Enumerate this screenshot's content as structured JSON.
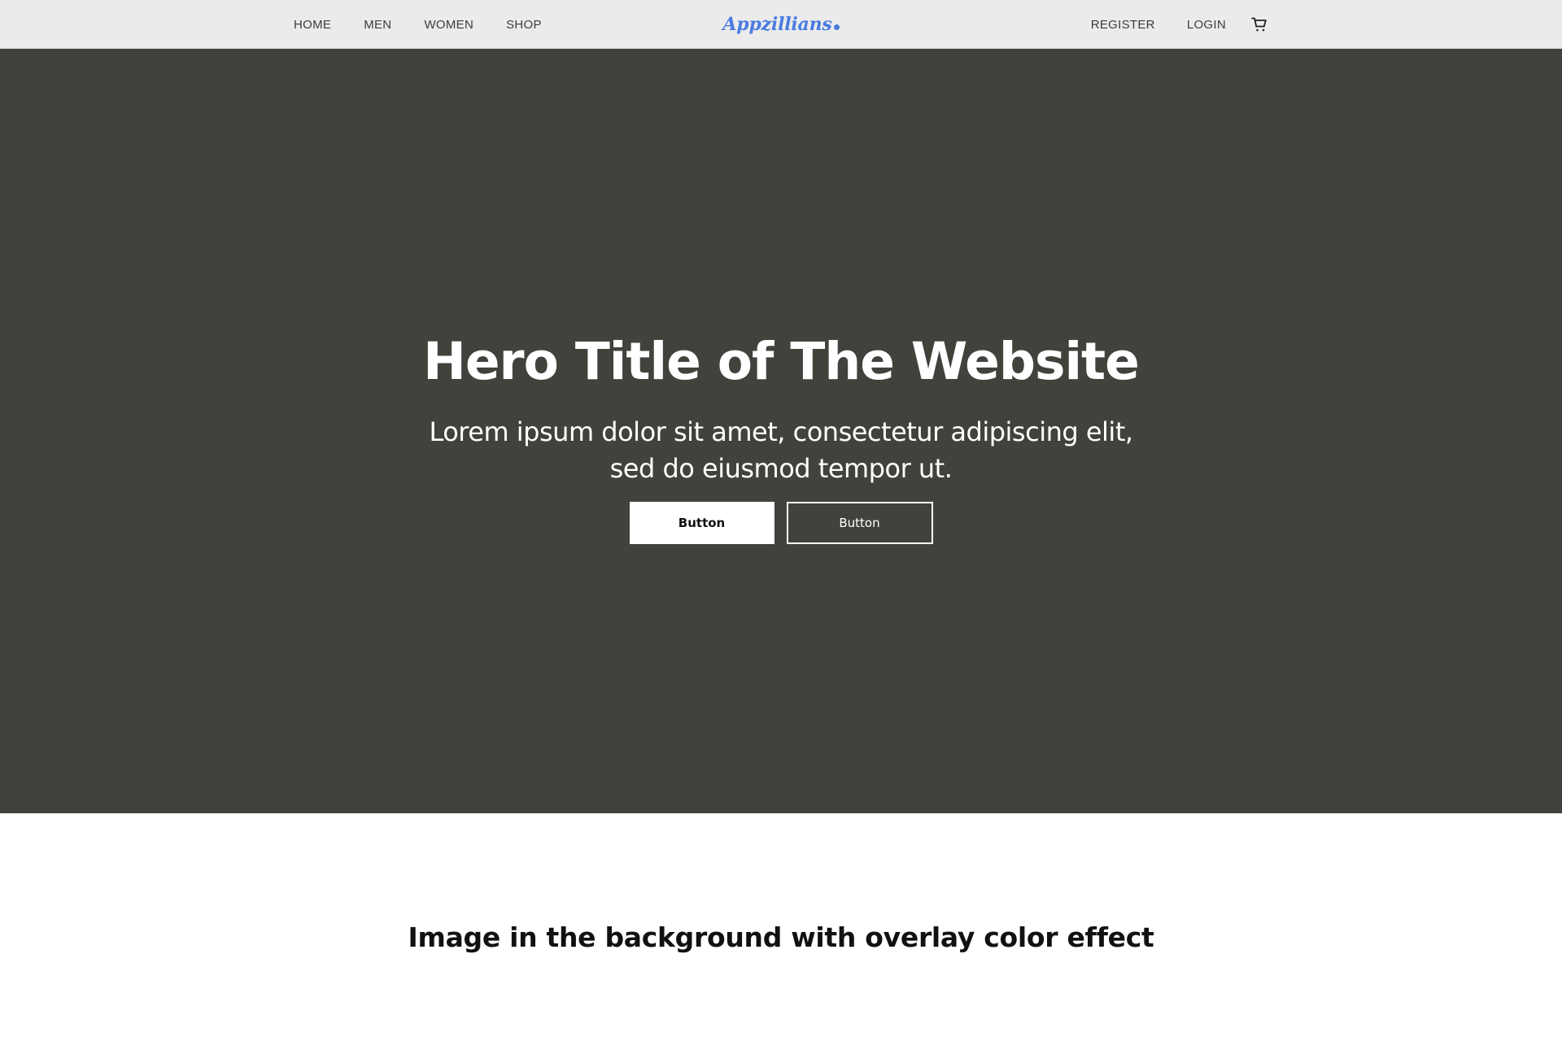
{
  "nav": {
    "left_links": [
      "HOME",
      "MEN",
      "WOMEN",
      "SHOP"
    ],
    "right_links": [
      "REGISTER",
      "LOGIN"
    ],
    "brand": "Appzillians",
    "cart_icon": "cart-icon"
  },
  "hero": {
    "title": "Hero Title of The Website",
    "subtitle_line1": "Lorem ipsum dolor sit amet, consectetur adipiscing elit,",
    "subtitle_line2": "sed do eiusmod tempor ut.",
    "primary_button": "Button",
    "secondary_button": "Button"
  },
  "caption": "Image in the background with overlay color effect",
  "colors": {
    "navbar_bg": "#ebebeb",
    "brand": "#4a7be0",
    "hero_bg": "#42423d",
    "hero_text": "#ffffff",
    "page_bg": "#ffffff"
  }
}
